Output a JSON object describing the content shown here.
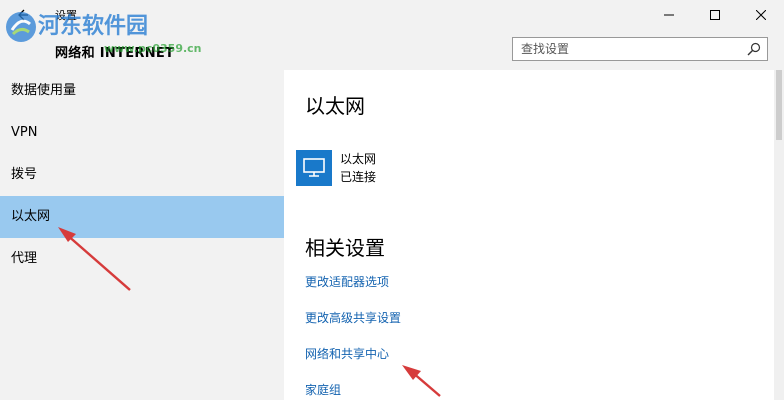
{
  "window": {
    "title": "设置",
    "section": "网络和 INTERNET",
    "controls": {
      "minimize_icon": "minimize-icon",
      "maximize_icon": "maximize-icon",
      "close_icon": "close-icon"
    }
  },
  "search": {
    "placeholder": "查找设置",
    "icon": "search-icon"
  },
  "sidebar": {
    "items": [
      {
        "label": "数据使用量",
        "active": false
      },
      {
        "label": "VPN",
        "active": false
      },
      {
        "label": "拨号",
        "active": false
      },
      {
        "label": "以太网",
        "active": true
      },
      {
        "label": "代理",
        "active": false
      }
    ]
  },
  "main": {
    "title": "以太网",
    "device": {
      "name": "以太网",
      "status": "已连接",
      "icon": "ethernet-monitor-icon"
    },
    "related": {
      "title": "相关设置",
      "links": [
        "更改适配器选项",
        "更改高级共享设置",
        "网络和共享中心",
        "家庭组"
      ]
    }
  },
  "watermark": {
    "text": "河东软件园",
    "url": "www.pc0359.cn"
  },
  "colors": {
    "accent": "#1979ca",
    "selected": "#99c9ef",
    "link": "#1463b0",
    "sidebar_bg": "#f2f2f2",
    "annotation_arrow": "#d63b3b"
  }
}
